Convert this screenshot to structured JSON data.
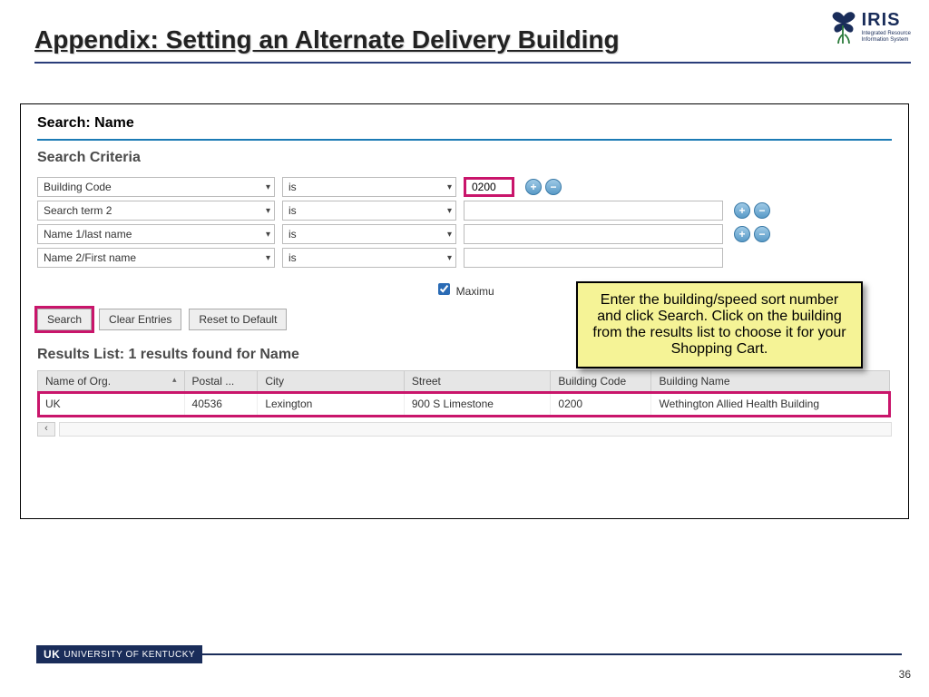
{
  "slide": {
    "title": "Appendix: Setting an Alternate Delivery Building",
    "page_number": "36"
  },
  "logo": {
    "main": "IRIS",
    "sub1": "Integrated Resource",
    "sub2": "Information System"
  },
  "panel": {
    "header": "Search: Name",
    "criteria_label": "Search Criteria",
    "rows": [
      {
        "field": "Building Code",
        "operator": "is",
        "value": "0200",
        "highlight_value": true,
        "show_pm": true
      },
      {
        "field": "Search term 2",
        "operator": "is",
        "value": "",
        "highlight_value": false,
        "show_pm": true
      },
      {
        "field": "Name 1/last name",
        "operator": "is",
        "value": "",
        "highlight_value": false,
        "show_pm": true
      },
      {
        "field": "Name 2/First name",
        "operator": "is",
        "value": "",
        "highlight_value": false,
        "show_pm": false
      }
    ],
    "max_label_visible": "Maximu",
    "buttons": {
      "search": "Search",
      "clear": "Clear Entries",
      "reset": "Reset to Default"
    },
    "results_label": "Results List: 1 results found for Name",
    "columns": [
      "Name of Org.",
      "Postal ...",
      "City",
      "Street",
      "Building Code",
      "Building Name"
    ],
    "result_rows": [
      {
        "org": "UK",
        "postal": "40536",
        "city": "Lexington",
        "street": "900 S Limestone",
        "bcode": "0200",
        "bname": "Wethington Allied Health Building"
      }
    ]
  },
  "callout": {
    "text": "Enter the building/speed sort number and click Search. Click on the building from the results list to choose it for your Shopping Cart."
  },
  "footer": {
    "uk_bold": "UK",
    "uk_text": "UNIVERSITY OF KENTUCKY"
  }
}
